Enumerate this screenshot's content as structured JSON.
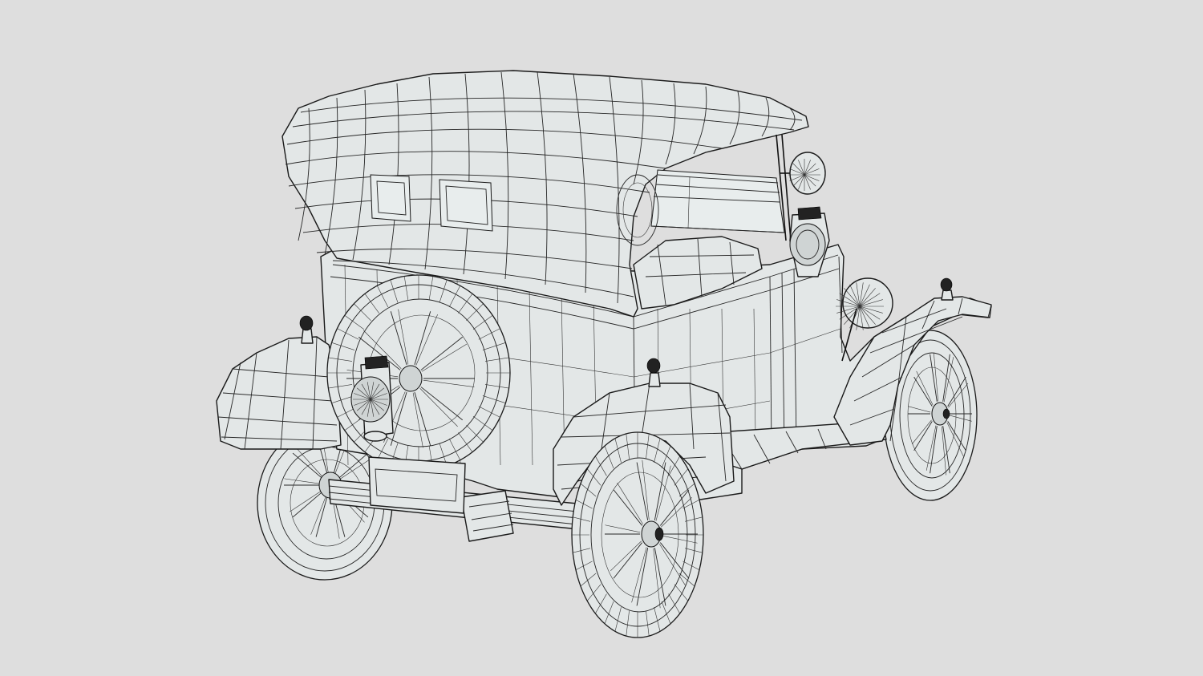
{
  "scene": {
    "background_color": "#dedede",
    "mesh_fill_color": "#e3e7e7",
    "wire_color": "#1a1a1a",
    "subject_icon": "vintage-car-wireframe-icon"
  }
}
